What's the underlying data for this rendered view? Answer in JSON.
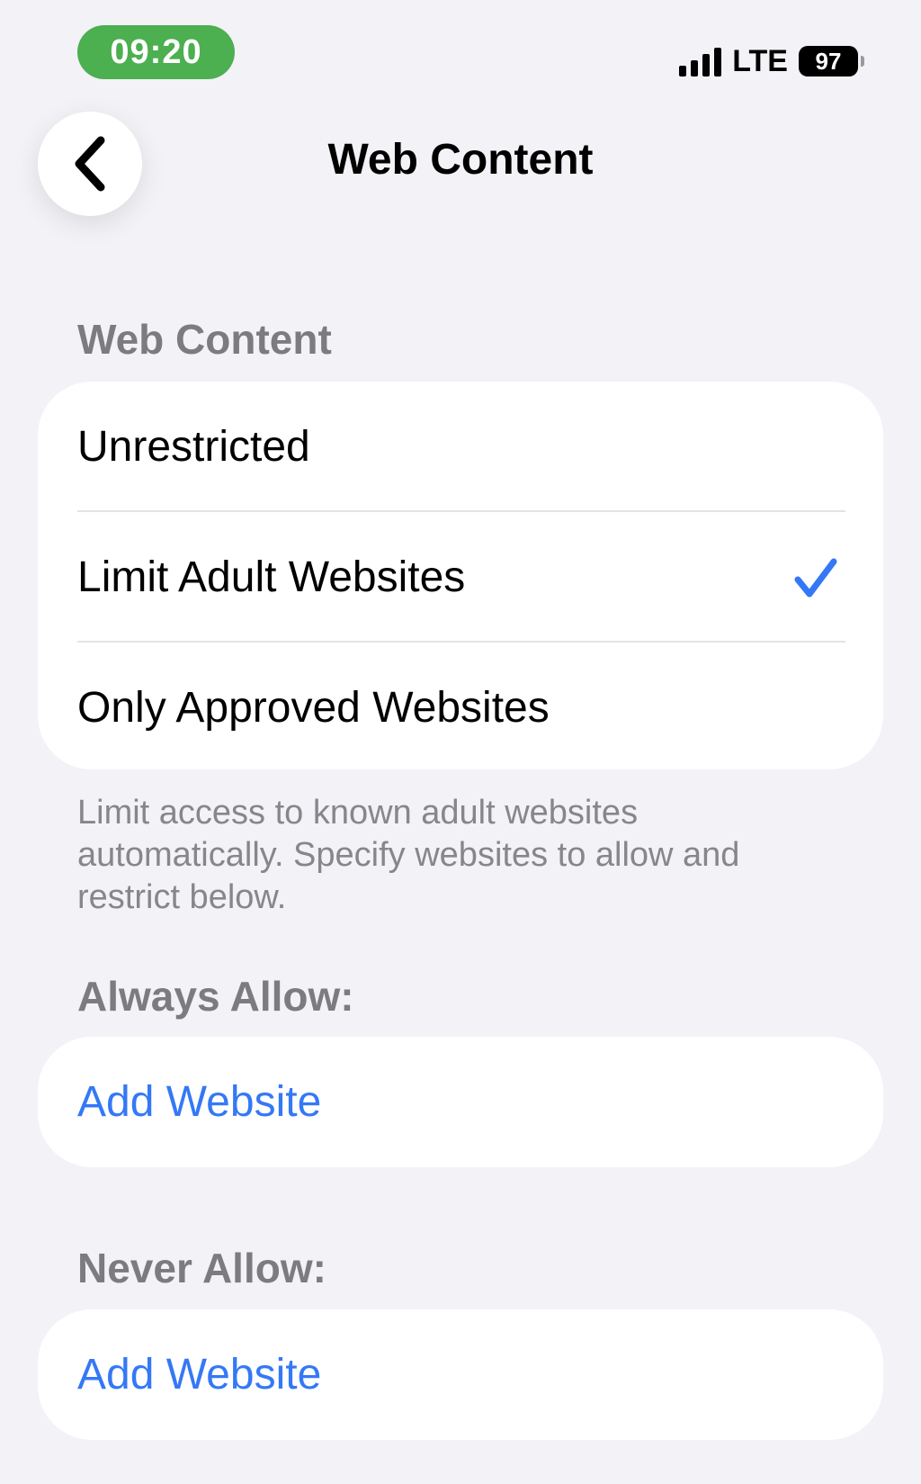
{
  "status_bar": {
    "time": "09:20",
    "network": "LTE",
    "battery": "97"
  },
  "nav": {
    "back_icon": "chevron-left-icon",
    "title": "Web Content"
  },
  "web_content_section": {
    "header": "Web Content",
    "options": [
      {
        "label": "Unrestricted",
        "selected": false
      },
      {
        "label": "Limit Adult Websites",
        "selected": true
      },
      {
        "label": "Only Approved Websites",
        "selected": false
      }
    ],
    "footer": "Limit access to known adult websites automatically. Specify websites to allow and restrict below."
  },
  "always_allow": {
    "header": "Always Allow:",
    "add_label": "Add Website"
  },
  "never_allow": {
    "header": "Never Allow:",
    "add_label": "Add Website"
  },
  "colors": {
    "background": "#f2f2f7",
    "accent": "#3478f6",
    "time_pill": "#4caf50",
    "secondary_text": "#86868b"
  }
}
